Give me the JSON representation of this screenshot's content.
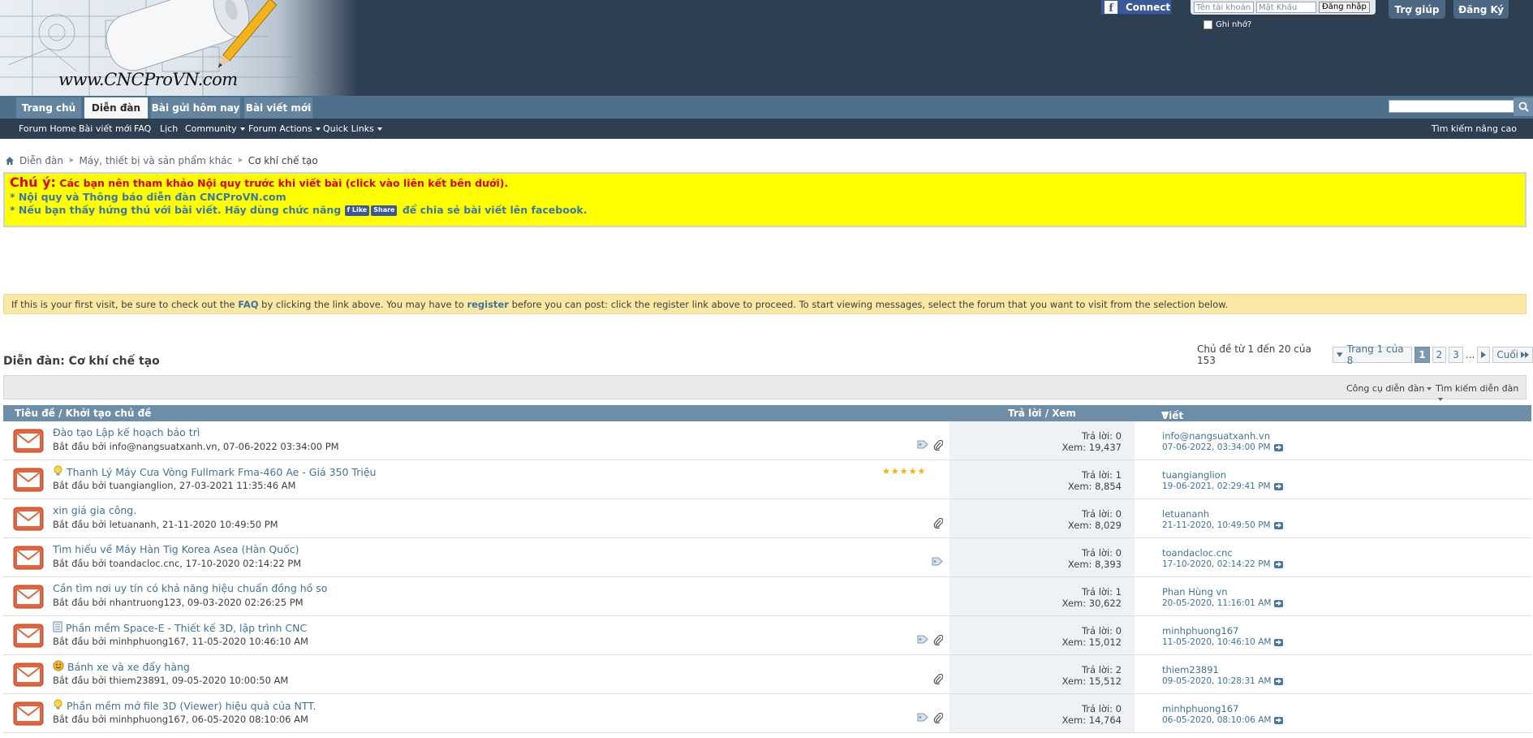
{
  "header": {
    "logo_text": "www.CNCProVN.com",
    "connect_label": "Connect",
    "username_placeholder": "Tên tài khoản",
    "password_placeholder": "Mật Khẩu",
    "login_label": "Đăng nhập",
    "remember_label": "Ghi nhớ?",
    "help_label": "Trợ giúp",
    "register_label": "Đăng Ký"
  },
  "tabs": [
    {
      "label": "Trang chủ",
      "selected": false
    },
    {
      "label": "Diễn đàn",
      "selected": true
    },
    {
      "label": "Bài gửi hôm nay",
      "selected": false
    },
    {
      "label": "Bài viết mới",
      "selected": false
    }
  ],
  "subnav": {
    "items": [
      "Forum Home",
      "Bài viết mới",
      "FAQ",
      "Lịch",
      "Community",
      "Forum Actions",
      "Quick Links"
    ],
    "advanced_search": "Tìm kiếm nâng cao"
  },
  "breadcrumb": [
    "Diễn đàn",
    "Máy, thiết bị và sản phẩm khác",
    "Cơ khí chế tạo"
  ],
  "notice": {
    "label": "Chú ý:",
    "line1": "Các bạn nên tham khảo Nội quy trước khi viết bài (click vào liên kết bên dưới).",
    "line2": "* Nội quy và Thông báo diễn đàn CNCProVN.com",
    "line3_a": "* Nếu bạn thấy hứng thú với bài viết. Hãy dùng chức năng",
    "like_label": "Like",
    "share_label": "Share",
    "line3_b": "để chia sẻ bài viết lên facebook."
  },
  "infobar": {
    "part1": "If this is your first visit, be sure to check out the",
    "faq": "FAQ",
    "part2": "by clicking the link above. You may have to",
    "register": "register",
    "part3": "before you can post: click the register link above to proceed. To start viewing messages, select the forum that you want to visit from the selection below."
  },
  "forum_title": "Diễn đàn: Cơ khí chế tạo",
  "pagination": {
    "summary": "Chủ đề từ 1 đến 20 của 153",
    "page_of": "Trang 1 của 8",
    "pages": [
      "1",
      "2",
      "3"
    ],
    "ellipsis": "...",
    "last_label": "Cuối"
  },
  "tools": {
    "forum_tools": "Công cụ diễn đàn",
    "search_forum": "Tìm kiếm diễn đàn"
  },
  "columns": {
    "title": "Tiêu đề / Khởi tạo chủ đề",
    "replies": "Trả lời / Xem",
    "last_post": "Viết bài cuối bởi"
  },
  "threads": [
    {
      "title": "Đào tạo Lập kế hoạch bảo trì",
      "starter": "Bắt đầu bởi info@nangsuatxanh.vn, 07-06-2022 03:34:00 PM",
      "replies": "Trả lời: 0",
      "views": "Xem: 19,437",
      "last_user": "info@nangsuatxanh.vn",
      "last_date": "07-06-2022, 03:34:00 PM",
      "prefix": "",
      "icons": [
        "tag",
        "attach"
      ],
      "rating": 0
    },
    {
      "title": "Thanh Lý Máy Cưa Vòng Fullmark Fma-460 Ae - Giá 350 Triệu",
      "starter": "Bắt đầu bởi tuangianglion, 27-03-2021 11:35:46 AM",
      "replies": "Trả lời: 1",
      "views": "Xem: 8,854",
      "last_user": "tuangianglion",
      "last_date": "19-06-2021, 02:29:41 PM",
      "prefix": "bulb",
      "icons": [],
      "rating": 5
    },
    {
      "title": "xin giá gia công.",
      "starter": "Bắt đầu bởi letuananh, 21-11-2020 10:49:50 PM",
      "replies": "Trả lời: 0",
      "views": "Xem: 8,029",
      "last_user": "letuananh",
      "last_date": "21-11-2020, 10:49:50 PM",
      "prefix": "",
      "icons": [
        "attach"
      ],
      "rating": 0
    },
    {
      "title": "Tìm hiểu về Máy Hàn Tig Korea Asea (Hàn Quốc)",
      "starter": "Bắt đầu bởi toandacloc.cnc, 17-10-2020 02:14:22 PM",
      "replies": "Trả lời: 0",
      "views": "Xem: 8,393",
      "last_user": "toandacloc.cnc",
      "last_date": "17-10-2020, 02:14:22 PM",
      "prefix": "",
      "icons": [
        "tag"
      ],
      "rating": 0
    },
    {
      "title": "Cần tìm nơi uy tín có khả năng hiệu chuẩn đồng hồ so",
      "starter": "Bắt đầu bởi nhantruong123, 09-03-2020 02:26:25 PM",
      "replies": "Trả lời: 1",
      "views": "Xem: 30,622",
      "last_user": "Phan Hùng vn",
      "last_date": "20-05-2020, 11:16:01 AM",
      "prefix": "",
      "icons": [],
      "rating": 0
    },
    {
      "title": "Phần mềm Space-E - Thiết kế 3D, lập trình CNC",
      "starter": "Bắt đầu bởi minhphuong167, 11-05-2020 10:46:10 AM",
      "replies": "Trả lời: 0",
      "views": "Xem: 15,012",
      "last_user": "minhphuong167",
      "last_date": "11-05-2020, 10:46:10 AM",
      "prefix": "doc",
      "icons": [
        "tag",
        "attach"
      ],
      "rating": 0
    },
    {
      "title": "Bánh xe và xe đẩy hàng",
      "starter": "Bắt đầu bởi thiem23891, 09-05-2020 10:00:50 AM",
      "replies": "Trả lời: 2",
      "views": "Xem: 15,512",
      "last_user": "thiem23891",
      "last_date": "09-05-2020, 10:28:31 AM",
      "prefix": "smile",
      "icons": [
        "attach"
      ],
      "rating": 0
    },
    {
      "title": "Phần mềm mở file 3D (Viewer) hiệu quả của NTT.",
      "starter": "Bắt đầu bởi minhphuong167, 06-05-2020 08:10:06 AM",
      "replies": "Trả lời: 0",
      "views": "Xem: 14,764",
      "last_user": "minhphuong167",
      "last_date": "06-05-2020, 08:10:06 AM",
      "prefix": "bulb",
      "icons": [
        "tag",
        "attach"
      ],
      "rating": 0
    }
  ]
}
